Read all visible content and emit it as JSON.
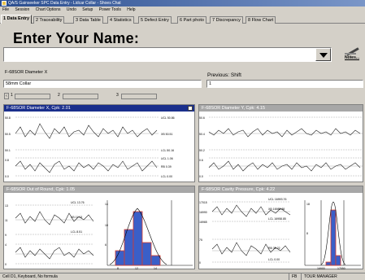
{
  "window": {
    "title": "QA/S Gainseeker SPC Data Entry - Lidcar Collar - Shoes Chat"
  },
  "menu": [
    "File",
    "Session",
    "Chart Options",
    "Undo",
    "Setup",
    "Power Tools",
    "Help"
  ],
  "tabs": [
    {
      "label": "1 Data Entry"
    },
    {
      "label": "2 Traceability"
    },
    {
      "label": "3 Data Table"
    },
    {
      "label": "4 Statistics"
    },
    {
      "label": "5 Defect Entry"
    },
    {
      "label": "6 Part photo"
    },
    {
      "label": "7 Discrepancy"
    },
    {
      "label": "8 Flow Chart"
    }
  ],
  "entry": {
    "prompt": "Enter Your Name:",
    "name_value": "",
    "notes_label": "Notes..."
  },
  "fields": {
    "characteristic": "F-68SOR Diameter X",
    "part": "58mm Collar",
    "previous_label": "Previous: Shift",
    "previous_value": "1",
    "counter_1": "1",
    "counter_2": "2",
    "counter_3": "3"
  },
  "panels": [
    {
      "title": "F-68SOR Diameter X, Cpk: 2.01",
      "active": true
    },
    {
      "title": "F-68SOR Diameter Y, Cpk: 4.15",
      "active": false
    },
    {
      "title": "F-68SOR Out of Round, Cpk: 1.05",
      "active": false
    },
    {
      "title": "F-68SOR Cavity Pressure, Cpk: 4.22",
      "active": false
    }
  ],
  "status": {
    "left": "Cell D1, Keyboard, No formula",
    "mode": "FB",
    "user": "TOUR MANAGER"
  },
  "colors": {
    "active_header": "#1a2f8c",
    "inactive_header": "#a7a7a7",
    "histogram_bar": "#3a5fc8",
    "histogram_edge": "#d93a2a"
  }
}
